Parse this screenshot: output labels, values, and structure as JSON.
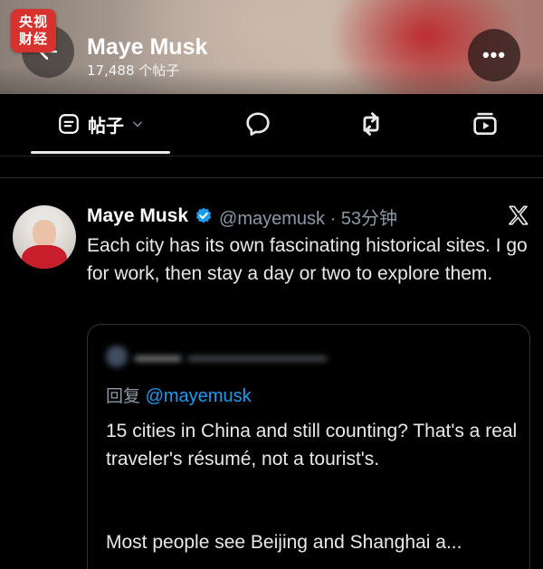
{
  "watermark": {
    "text_line1": "央视",
    "text_line2": "财经",
    "color": "#d8322e"
  },
  "header": {
    "profile_name": "Maye Musk",
    "post_count": "17,488 个帖子",
    "back_icon": "arrow-left-icon",
    "more_icon": "more-dots-icon",
    "more_label": "•••"
  },
  "tabs": {
    "posts_label": "帖子",
    "posts_icon": "posts-icon",
    "chevron_icon": "chevron-down-icon",
    "others": [
      {
        "icon": "reply-bubble-icon"
      },
      {
        "icon": "retweet-icon"
      },
      {
        "icon": "media-icon"
      }
    ]
  },
  "tweet": {
    "author_name": "Maye Musk",
    "verified": true,
    "handle_time": "@mayemusk · 53分钟",
    "text": "Each city has its own fascinating historical sites. I go for work, then stay a day or two to explore them.",
    "platform_icon": "x-logo-icon",
    "accent_color": "#1d9bf0"
  },
  "quoted_tweet": {
    "reply_label": "回复",
    "reply_mention": "@mayemusk",
    "text": "15 cities in China and still counting? That's a real traveler's résumé, not a tourist's.",
    "text_continued": "Most people see Beijing and Shanghai a..."
  }
}
